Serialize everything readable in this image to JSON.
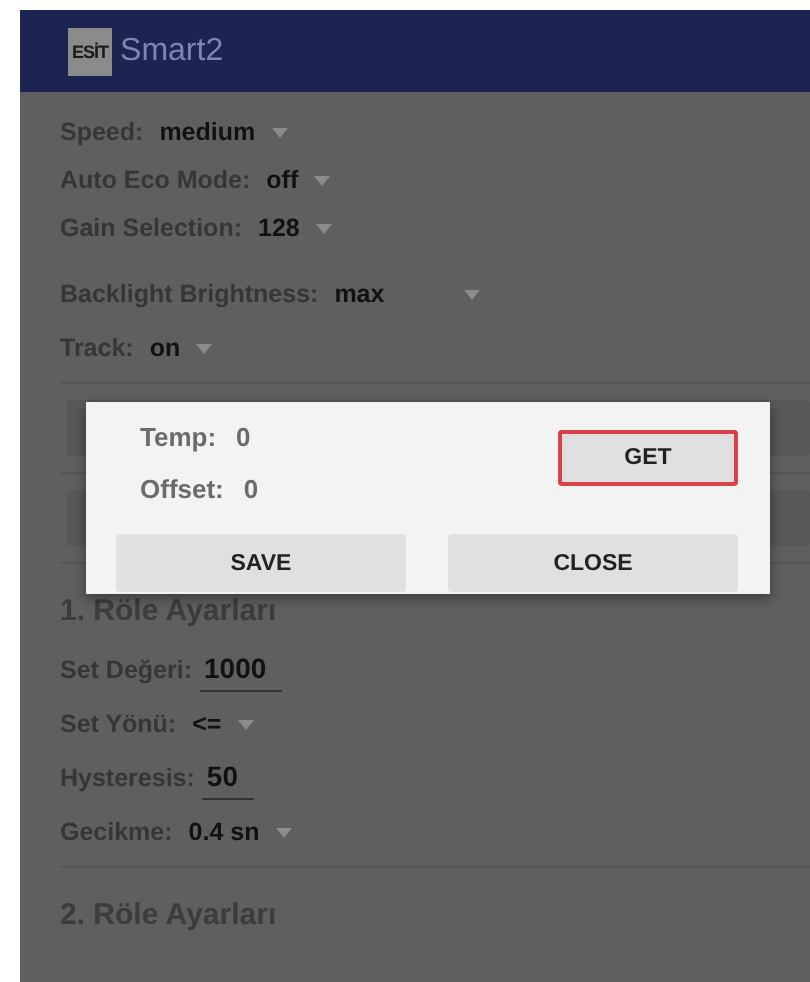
{
  "app_bar": {
    "logo": "ESİT",
    "title": "Smart2"
  },
  "general": [
    {
      "kind": "dropdown",
      "label": "Speed:",
      "value": "medium"
    },
    {
      "kind": "dropdown",
      "label": "Auto Eco Mode:",
      "value": "off"
    },
    {
      "kind": "dropdown",
      "label": "Gain Selection:",
      "value": "128"
    },
    {
      "kind": "dropdown",
      "label": "Backlight Brightness:",
      "value": "max",
      "wide": true
    },
    {
      "kind": "dropdown",
      "label": "Track:",
      "value": "on"
    }
  ],
  "relays": [
    {
      "title": "1. Röle Ayarları",
      "fields": [
        {
          "kind": "input",
          "label": "Set Değeri:",
          "value": "1000"
        },
        {
          "kind": "dropdown",
          "label": "Set Yönü:",
          "value": "<="
        },
        {
          "kind": "input",
          "label": "Hysteresis:",
          "value": "50"
        },
        {
          "kind": "dropdown",
          "label": "Gecikme:",
          "value": "0.4 sn"
        }
      ]
    },
    {
      "title": "2. Röle Ayarları"
    }
  ],
  "dialog": {
    "readings": [
      {
        "label": "Temp:",
        "value": "0"
      },
      {
        "label": "Offset:",
        "value": "0"
      }
    ],
    "get_button": {
      "label": "GET",
      "focused": true
    },
    "buttons": [
      "SAVE",
      "CLOSE"
    ]
  }
}
